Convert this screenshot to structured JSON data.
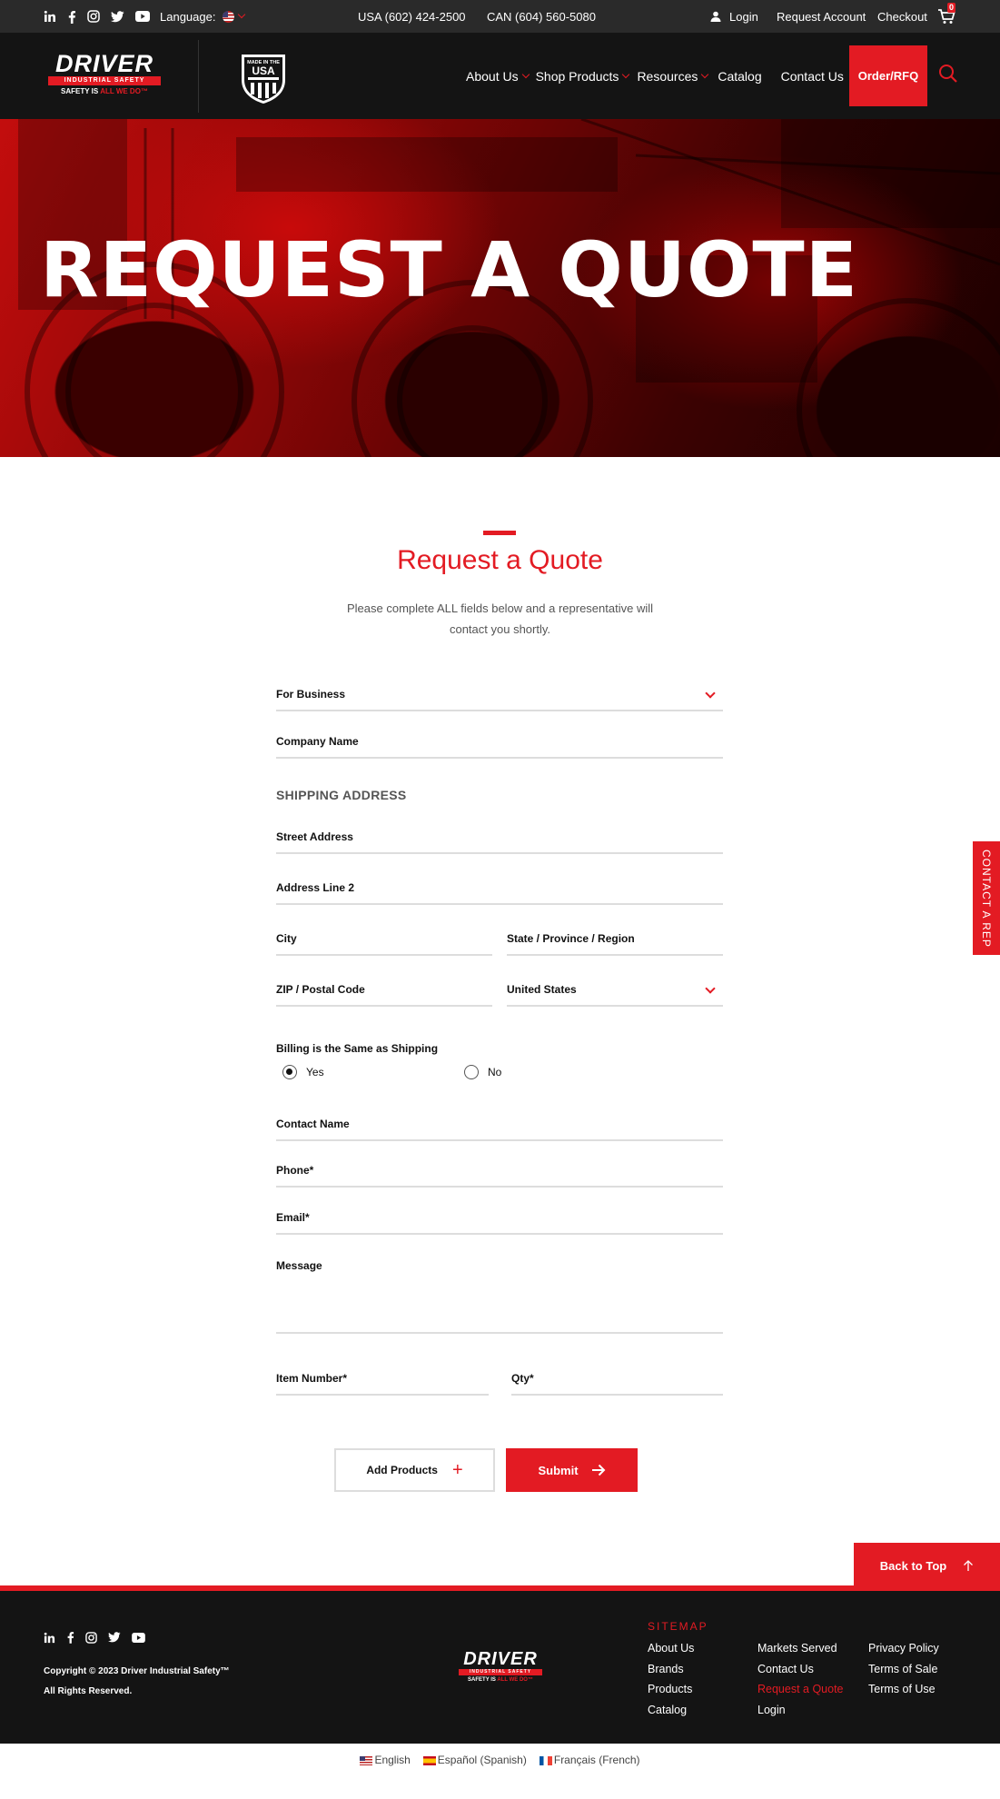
{
  "topbar": {
    "language_label": "Language:",
    "phone_usa": "USA (602) 424-2500",
    "phone_can": "CAN (604) 560-5080",
    "login": "Login",
    "request_account": "Request Account",
    "checkout": "Checkout",
    "cart_count": "0",
    "social_icons": [
      "linkedin-icon",
      "facebook-icon",
      "instagram-icon",
      "twitter-icon",
      "youtube-icon"
    ]
  },
  "brand": {
    "wordmark": "DRIVER",
    "subtitle": "INDUSTRIAL SAFETY",
    "tagline_prefix": "SAFETY IS",
    "tagline_accent": "ALL WE DO",
    "tagline_mark": "™",
    "badge_top": "MADE IN THE",
    "badge_main": "USA",
    "accent_color": "#e31b23"
  },
  "nav": {
    "about": "About Us",
    "shop": "Shop Products",
    "resources": "Resources",
    "catalog": "Catalog",
    "contact": "Contact Us",
    "order_rfq": "Order/RFQ"
  },
  "hero": {
    "title": "REQUEST A QUOTE"
  },
  "form": {
    "title": "Request a Quote",
    "intro": "Please complete ALL fields below and a representative will contact you shortly.",
    "customer_type": "For Business",
    "company_name": "Company Name",
    "shipping_heading": "SHIPPING ADDRESS",
    "street_address": "Street Address",
    "address_line2": "Address Line 2",
    "city": "City",
    "state": "State / Province / Region",
    "zip": "ZIP / Postal Code",
    "country": "United States",
    "billing_label": "Billing is the Same as Shipping",
    "billing_yes": "Yes",
    "billing_no": "No",
    "billing_selected": "Yes",
    "contact_name": "Contact Name",
    "phone": "Phone*",
    "email": "Email*",
    "message": "Message",
    "item_number": "Item Number*",
    "qty": "Qty*",
    "add_products": "Add Products",
    "submit": "Submit"
  },
  "side_tab": {
    "contact_rep": "CONTACT A REP"
  },
  "footer": {
    "back_to_top": "Back to Top",
    "copyright": "Copyright © 2023 Driver Industrial Safety™",
    "rights": "All Rights Reserved.",
    "sitemap_heading": "SITEMAP",
    "sitemap_col1": [
      "About Us",
      "Brands",
      "Products",
      "Catalog"
    ],
    "sitemap_col2": [
      "Markets Served",
      "Contact Us",
      "Request a Quote",
      "Login"
    ],
    "sitemap_col3": [
      "Privacy Policy",
      "Terms of Sale",
      "Terms of Use"
    ],
    "languages": [
      "English",
      "Español (Spanish)",
      "Français (French)"
    ]
  }
}
